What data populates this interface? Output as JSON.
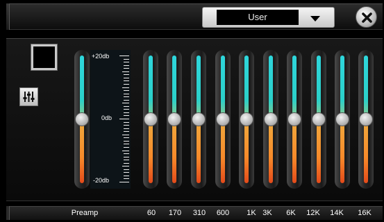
{
  "header": {
    "preset_value": "User",
    "preset_arrow_icon": "chevron-down-icon",
    "close_icon": "close-icon"
  },
  "controls": {
    "enable_toggle_icon": "square-toggle-icon",
    "eq_icon": "equalizer-sliders-icon"
  },
  "scale": {
    "top": "+20db",
    "mid": "0db",
    "bottom": "-20db",
    "range_db": [
      -20,
      20
    ]
  },
  "preamp": {
    "label": "Preamp",
    "value_db": 0
  },
  "bands": [
    {
      "label": "60",
      "value_db": 0
    },
    {
      "label": "170",
      "value_db": 0
    },
    {
      "label": "310",
      "value_db": 0
    },
    {
      "label": "600",
      "value_db": 0
    },
    {
      "label": "1K",
      "value_db": 0
    },
    {
      "label": "3K",
      "value_db": 0
    },
    {
      "label": "6K",
      "value_db": 0
    },
    {
      "label": "12K",
      "value_db": 0
    },
    {
      "label": "14K",
      "value_db": 0
    },
    {
      "label": "16K",
      "value_db": 0
    }
  ],
  "colors": {
    "accent_top": "#2ed6dc",
    "accent_bottom": "#e34a1a",
    "background": "#000000"
  }
}
